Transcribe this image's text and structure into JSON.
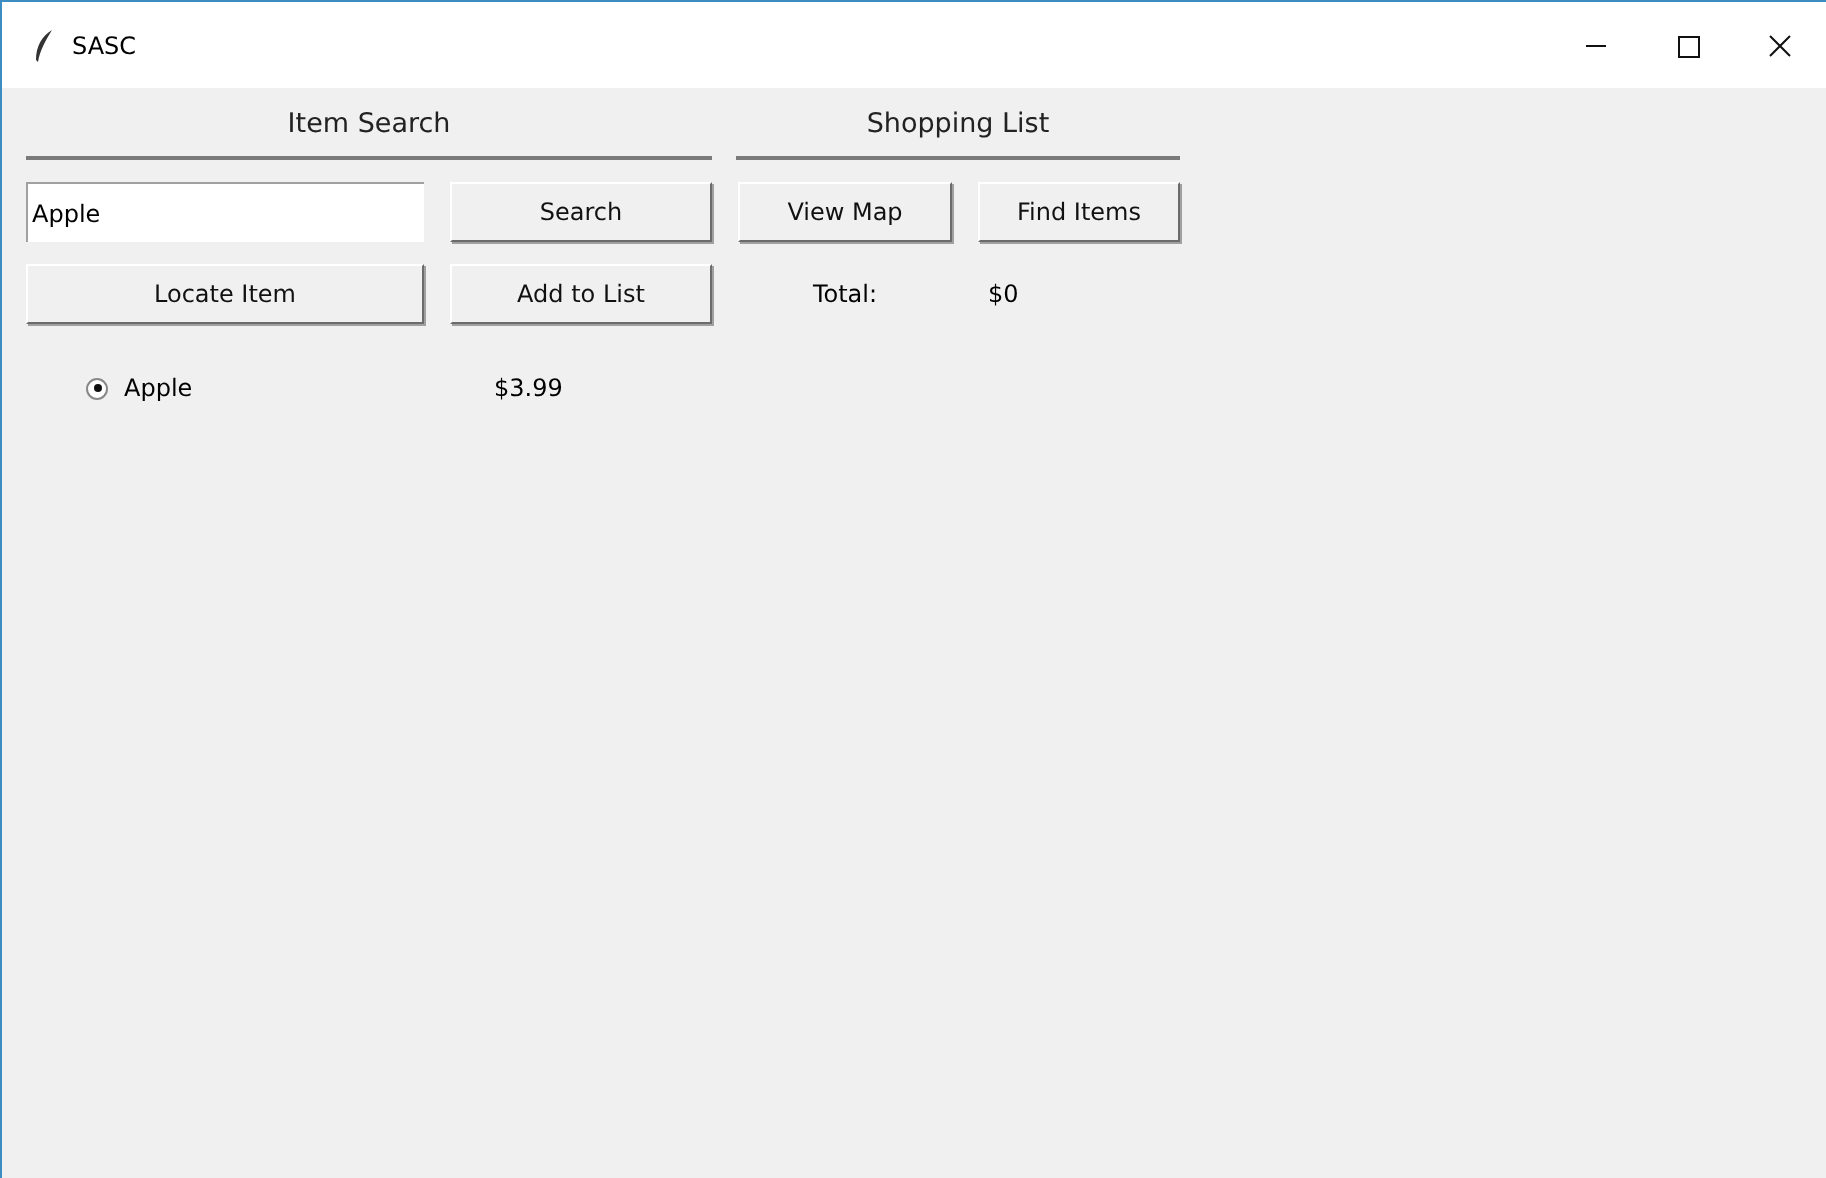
{
  "window": {
    "title": "SASC"
  },
  "item_search": {
    "heading": "Item Search",
    "search_field": {
      "value": "Apple"
    },
    "buttons": [
      "Search",
      "Locate Item",
      "Add to List"
    ]
  },
  "shopping_list": {
    "heading": "Shopping List",
    "buttons": [
      "View Map",
      "Find Items"
    ],
    "total_label": "Total:",
    "total_value": "$0"
  },
  "results": [
    {
      "name": "Apple",
      "price": "$3.99",
      "selected": true
    }
  ]
}
